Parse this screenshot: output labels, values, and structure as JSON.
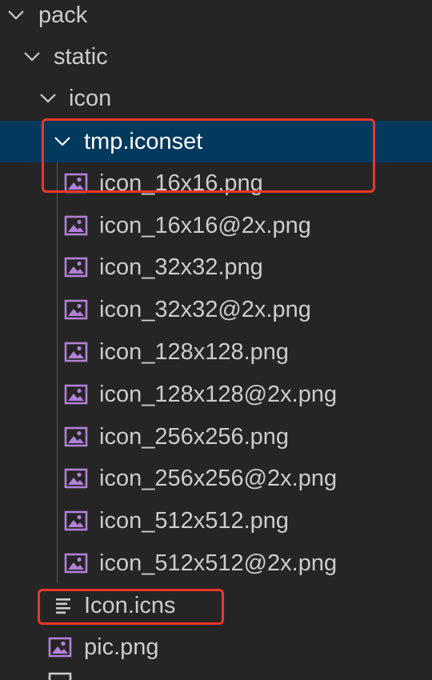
{
  "explorer": {
    "folders": {
      "pack": "pack",
      "static": "static",
      "icon": "icon",
      "iconset": "tmp.iconset"
    },
    "files": [
      "icon_16x16.png",
      "icon_16x16@2x.png",
      "icon_32x32.png",
      "icon_32x32@2x.png",
      "icon_128x128.png",
      "icon_128x128@2x.png",
      "icon_256x256.png",
      "icon_256x256@2x.png",
      "icon_512x512.png",
      "icon_512x512@2x.png"
    ],
    "icns_file": "Icon.icns",
    "pic_file": "pic.png"
  },
  "colors": {
    "background": "#252526",
    "selection": "#04395e",
    "text": "#cccccc",
    "image_icon": "#b180d7",
    "annotation": "#e8382b"
  },
  "icons": {
    "folder_toggle": "chevron-down-icon",
    "image_file": "image-file-icon",
    "text_file": "text-file-icon"
  }
}
